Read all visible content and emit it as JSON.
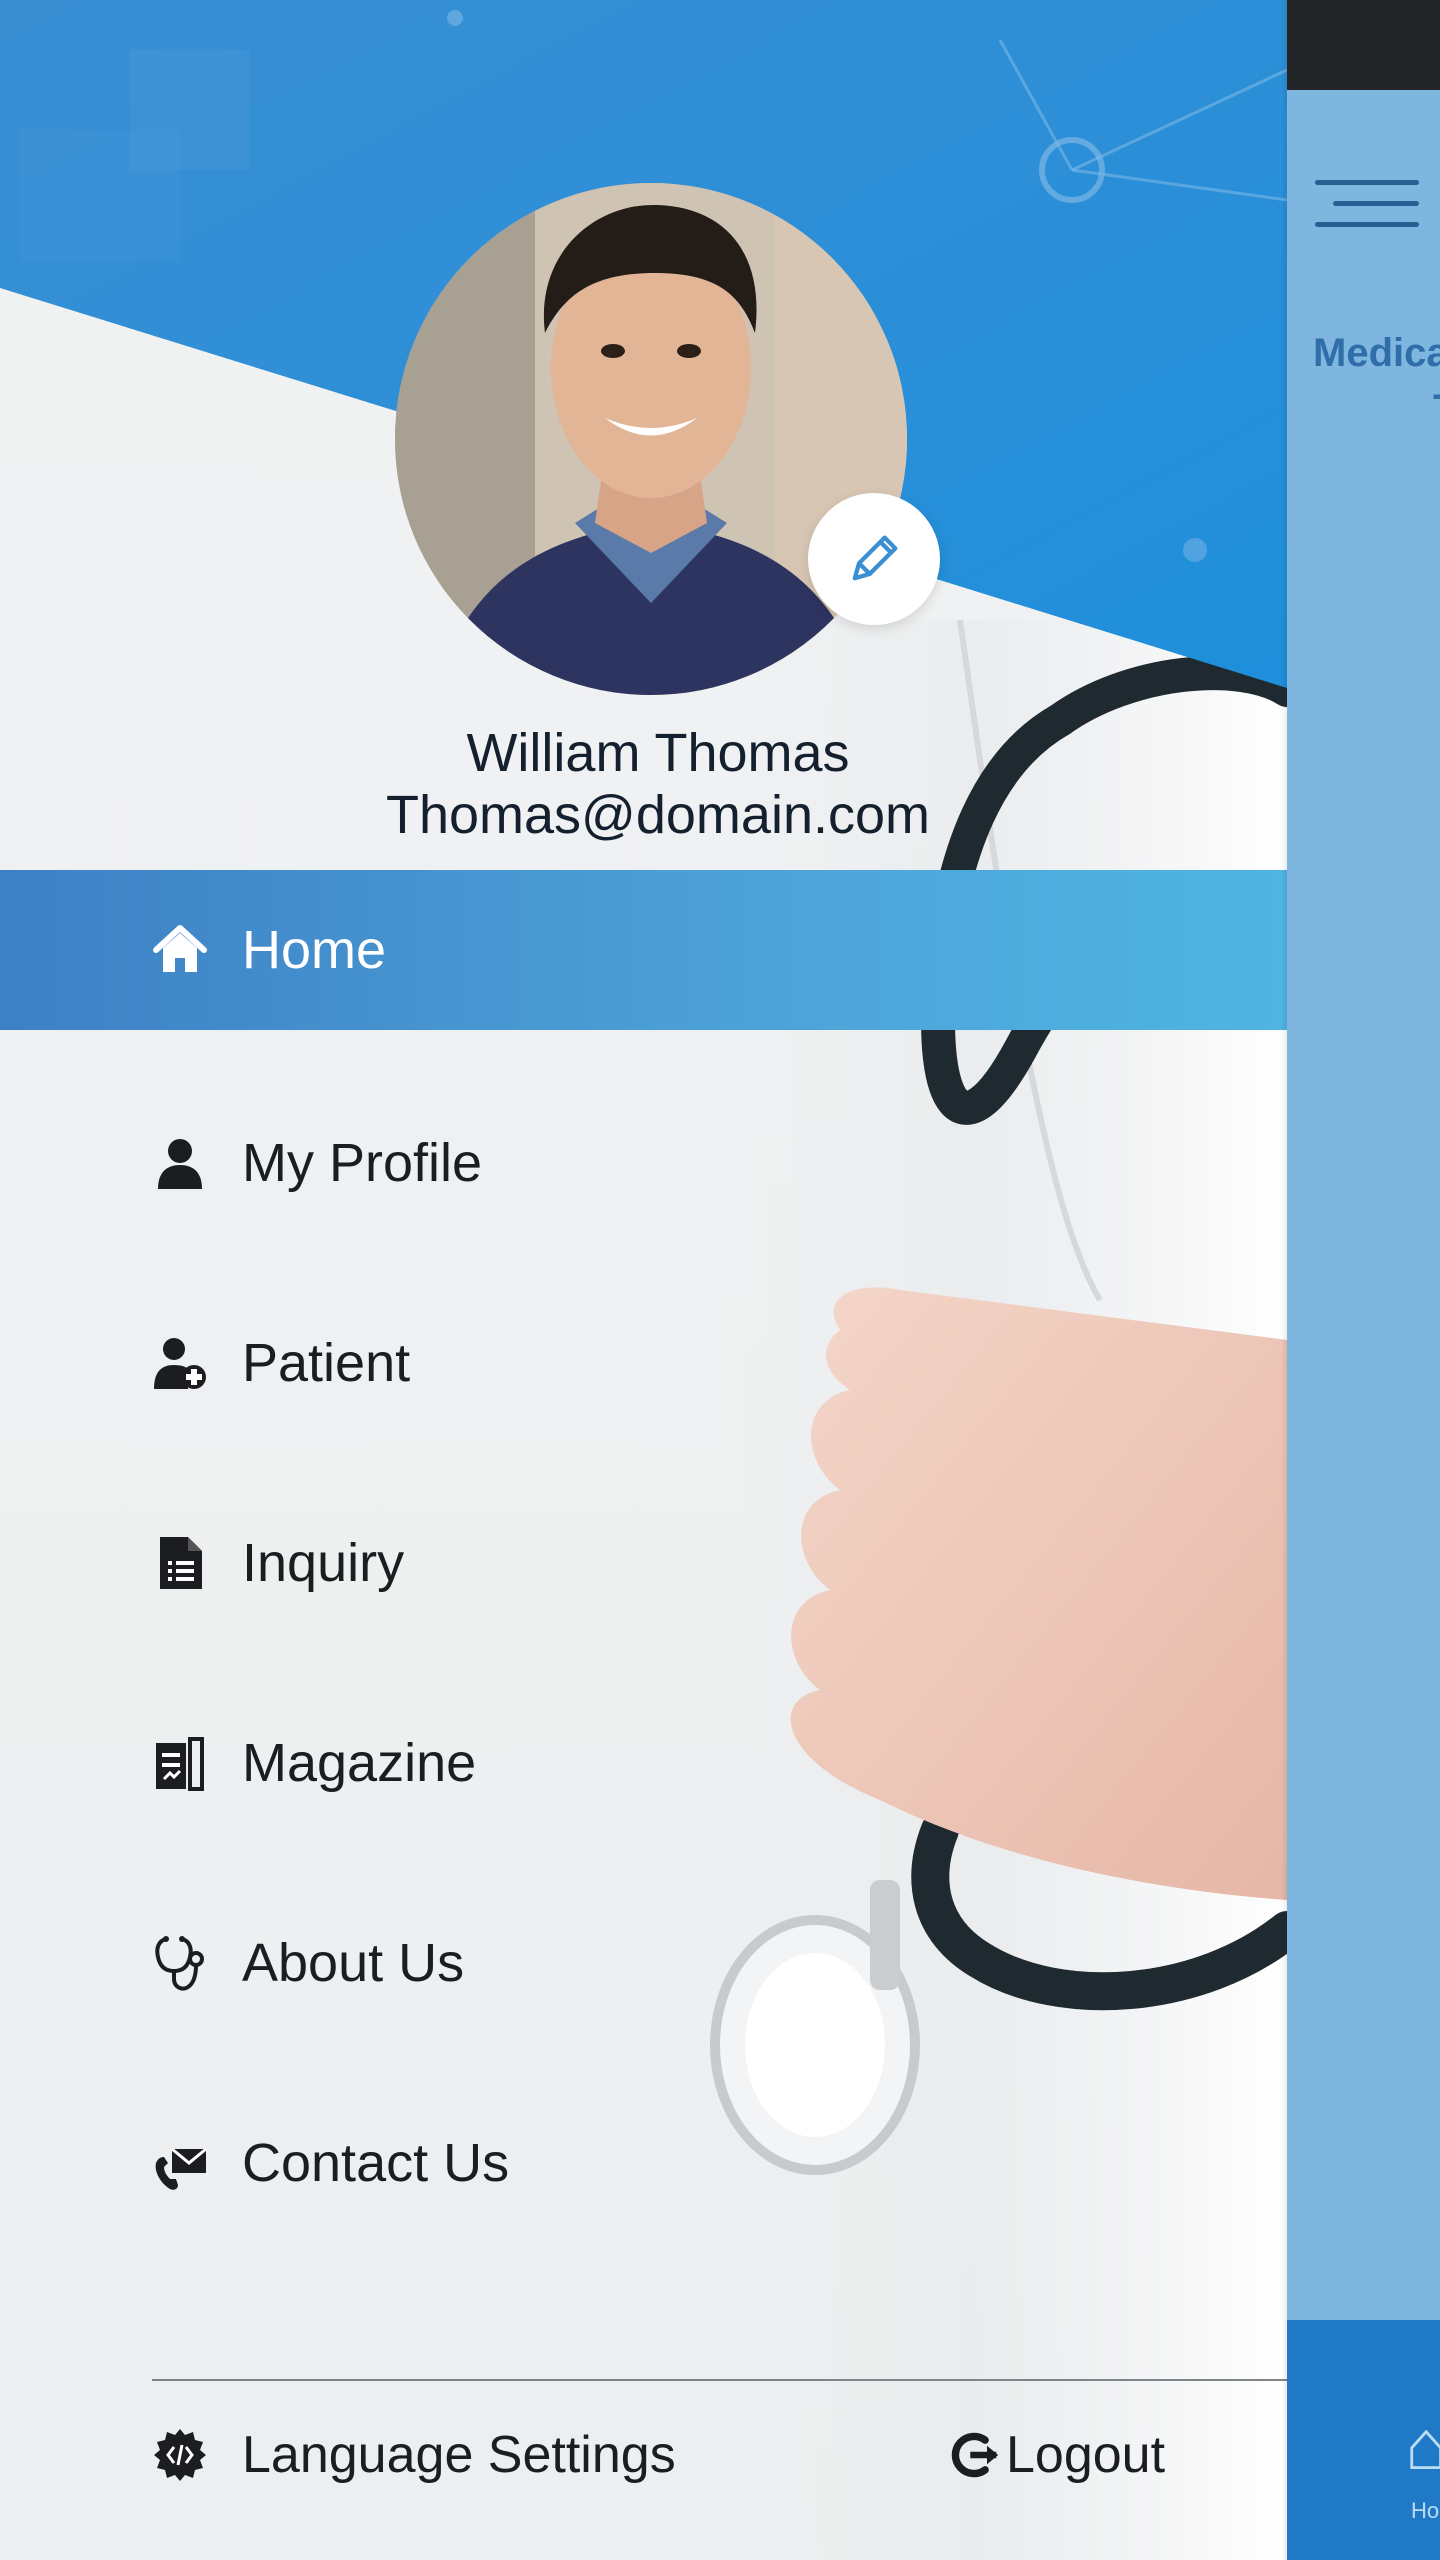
{
  "app": {
    "screen_title_line1": "Medica",
    "screen_title_line2": "T",
    "bottom_nav_home": "Ho"
  },
  "profile": {
    "name": "William Thomas",
    "email": "Thomas@domain.com"
  },
  "menu": {
    "items": [
      {
        "label": "Home",
        "icon": "home-icon",
        "active": true
      },
      {
        "label": "My Profile",
        "icon": "user-icon",
        "active": false
      },
      {
        "label": "Patient",
        "icon": "patient-icon",
        "active": false
      },
      {
        "label": "Inquiry",
        "icon": "document-icon",
        "active": false
      },
      {
        "label": "Magazine",
        "icon": "magazine-icon",
        "active": false
      },
      {
        "label": "About Us",
        "icon": "stethoscope-icon",
        "active": false
      },
      {
        "label": "Contact Us",
        "icon": "contact-icon",
        "active": false
      }
    ]
  },
  "footer": {
    "language_label": "Language Settings",
    "logout_label": "Logout"
  },
  "colors": {
    "header_blue": "#2a8fd6",
    "active_item": "#3d80c4",
    "text_dark": "#14202e",
    "underlay_blue": "#7eb6df"
  }
}
